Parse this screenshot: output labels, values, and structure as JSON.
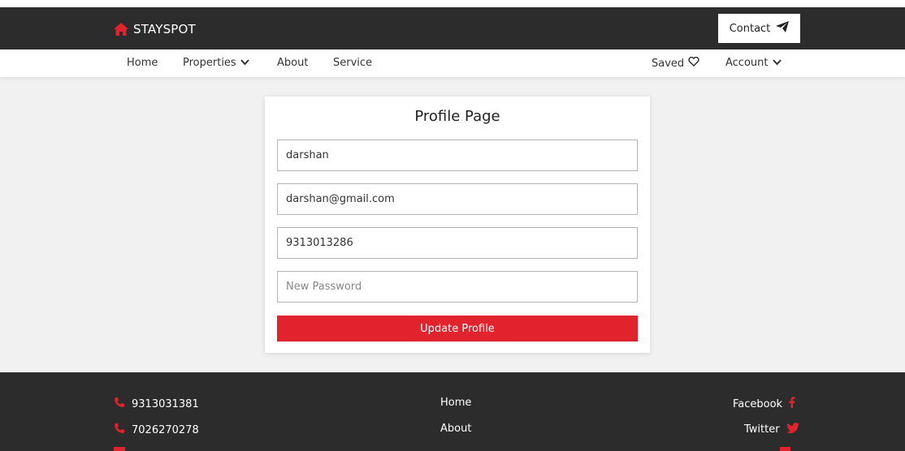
{
  "colors": {
    "accent": "#e0232d",
    "dark": "#2c2c2c",
    "light_bg": "#f1f1f1"
  },
  "header": {
    "brand": "STAYSPOT",
    "brand_icon": "home-icon",
    "contact_label": "Contact",
    "contact_icon": "paper-plane-icon"
  },
  "nav": {
    "home": "Home",
    "properties": "Properties",
    "about": "About",
    "service": "Service",
    "saved": "Saved",
    "account": "Account"
  },
  "profile": {
    "title": "Profile Page",
    "name_value": "darshan",
    "email_value": "darshan@gmail.com",
    "phone_value": "9313013286",
    "password_placeholder": "New Password",
    "update_label": "Update Profile"
  },
  "footer": {
    "phones": [
      "9313031381",
      "7026270278"
    ],
    "links": [
      "Home",
      "About"
    ],
    "social": [
      "Facebook",
      "Twitter"
    ]
  }
}
